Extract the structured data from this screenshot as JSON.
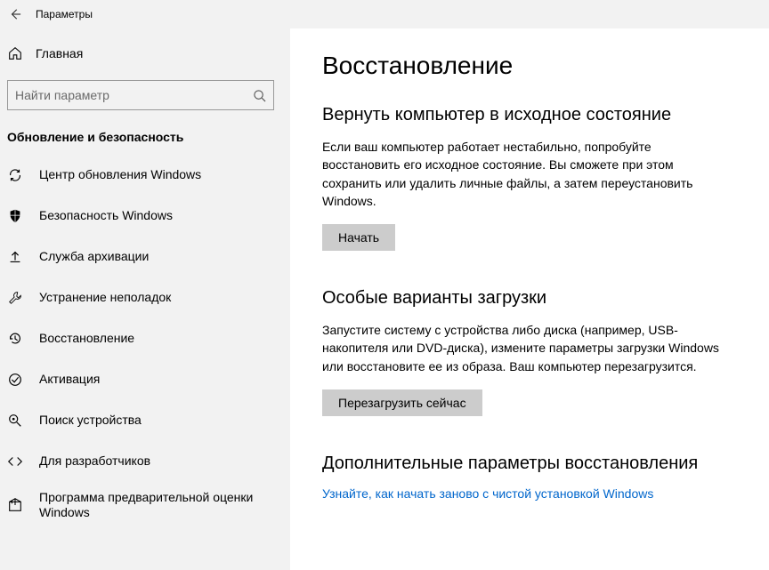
{
  "titlebar": {
    "title": "Параметры"
  },
  "sidebar": {
    "home": "Главная",
    "search_placeholder": "Найти параметр",
    "section": "Обновление и безопасность",
    "items": [
      {
        "label": "Центр обновления Windows"
      },
      {
        "label": "Безопасность Windows"
      },
      {
        "label": "Служба архивации"
      },
      {
        "label": "Устранение неполадок"
      },
      {
        "label": "Восстановление"
      },
      {
        "label": "Активация"
      },
      {
        "label": "Поиск устройства"
      },
      {
        "label": "Для разработчиков"
      },
      {
        "label": "Программа предварительной оценки Windows"
      }
    ]
  },
  "main": {
    "heading": "Восстановление",
    "section1": {
      "title": "Вернуть компьютер в исходное состояние",
      "desc": "Если ваш компьютер работает нестабильно, попробуйте восстановить его исходное состояние. Вы сможете при этом сохранить или удалить личные файлы, а затем переустановить Windows.",
      "button": "Начать"
    },
    "section2": {
      "title": "Особые варианты загрузки",
      "desc": "Запустите систему с устройства либо диска (например, USB-накопителя или DVD-диска), измените параметры загрузки Windows или восстановите ее из образа. Ваш компьютер перезагрузится.",
      "button": "Перезагрузить сейчас"
    },
    "section3": {
      "title": "Дополнительные параметры восстановления",
      "link": "Узнайте, как начать заново с чистой установкой Windows"
    }
  }
}
